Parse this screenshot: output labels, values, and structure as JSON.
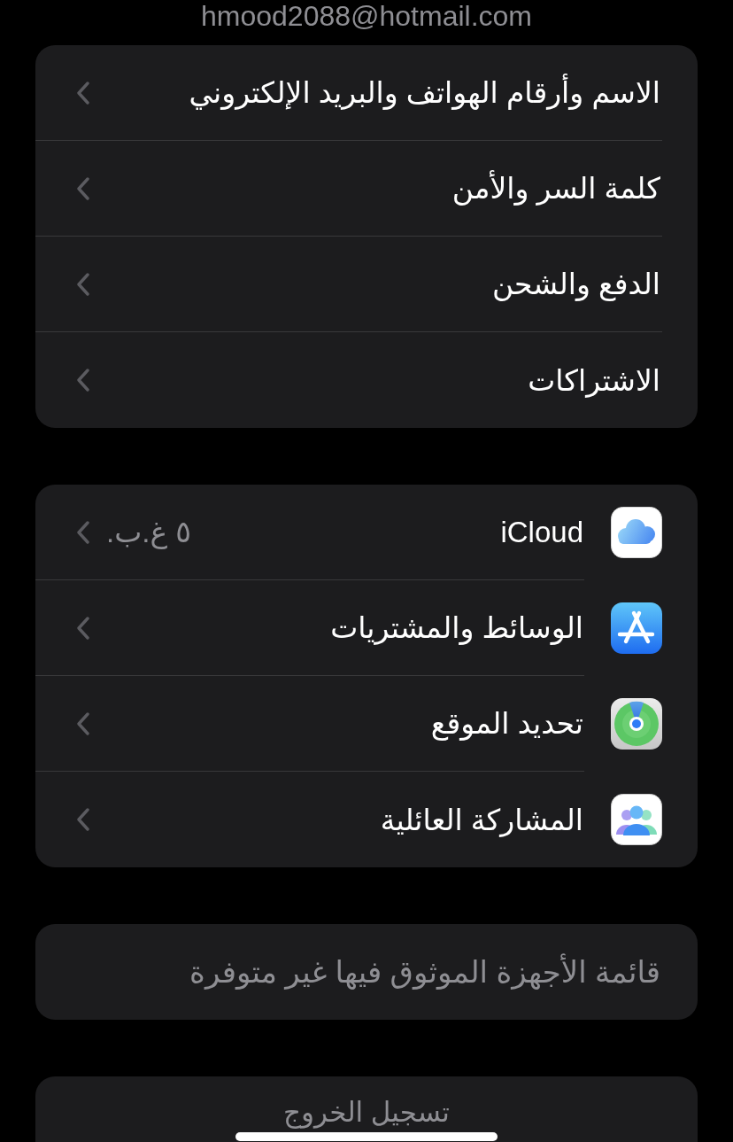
{
  "account_email": "hmood2088@hotmail.com",
  "account_section": {
    "rows": [
      {
        "label": "الاسم وأرقام الهواتف والبريد الإلكتروني"
      },
      {
        "label": "كلمة السر والأمن"
      },
      {
        "label": "الدفع والشحن"
      },
      {
        "label": "الاشتراكات"
      }
    ]
  },
  "services_section": {
    "rows": [
      {
        "kind": "icloud",
        "label": "iCloud",
        "detail": "٥ غ.ب."
      },
      {
        "kind": "app_store",
        "label": "الوسائط والمشتريات"
      },
      {
        "kind": "find_my",
        "label": "تحديد الموقع"
      },
      {
        "kind": "family",
        "label": "المشاركة العائلية"
      }
    ]
  },
  "devices_note": {
    "text": "قائمة الأجهزة الموثوق فيها غير متوفرة"
  },
  "sign_out": {
    "label": "تسجيل الخروج",
    "disabled": true
  }
}
